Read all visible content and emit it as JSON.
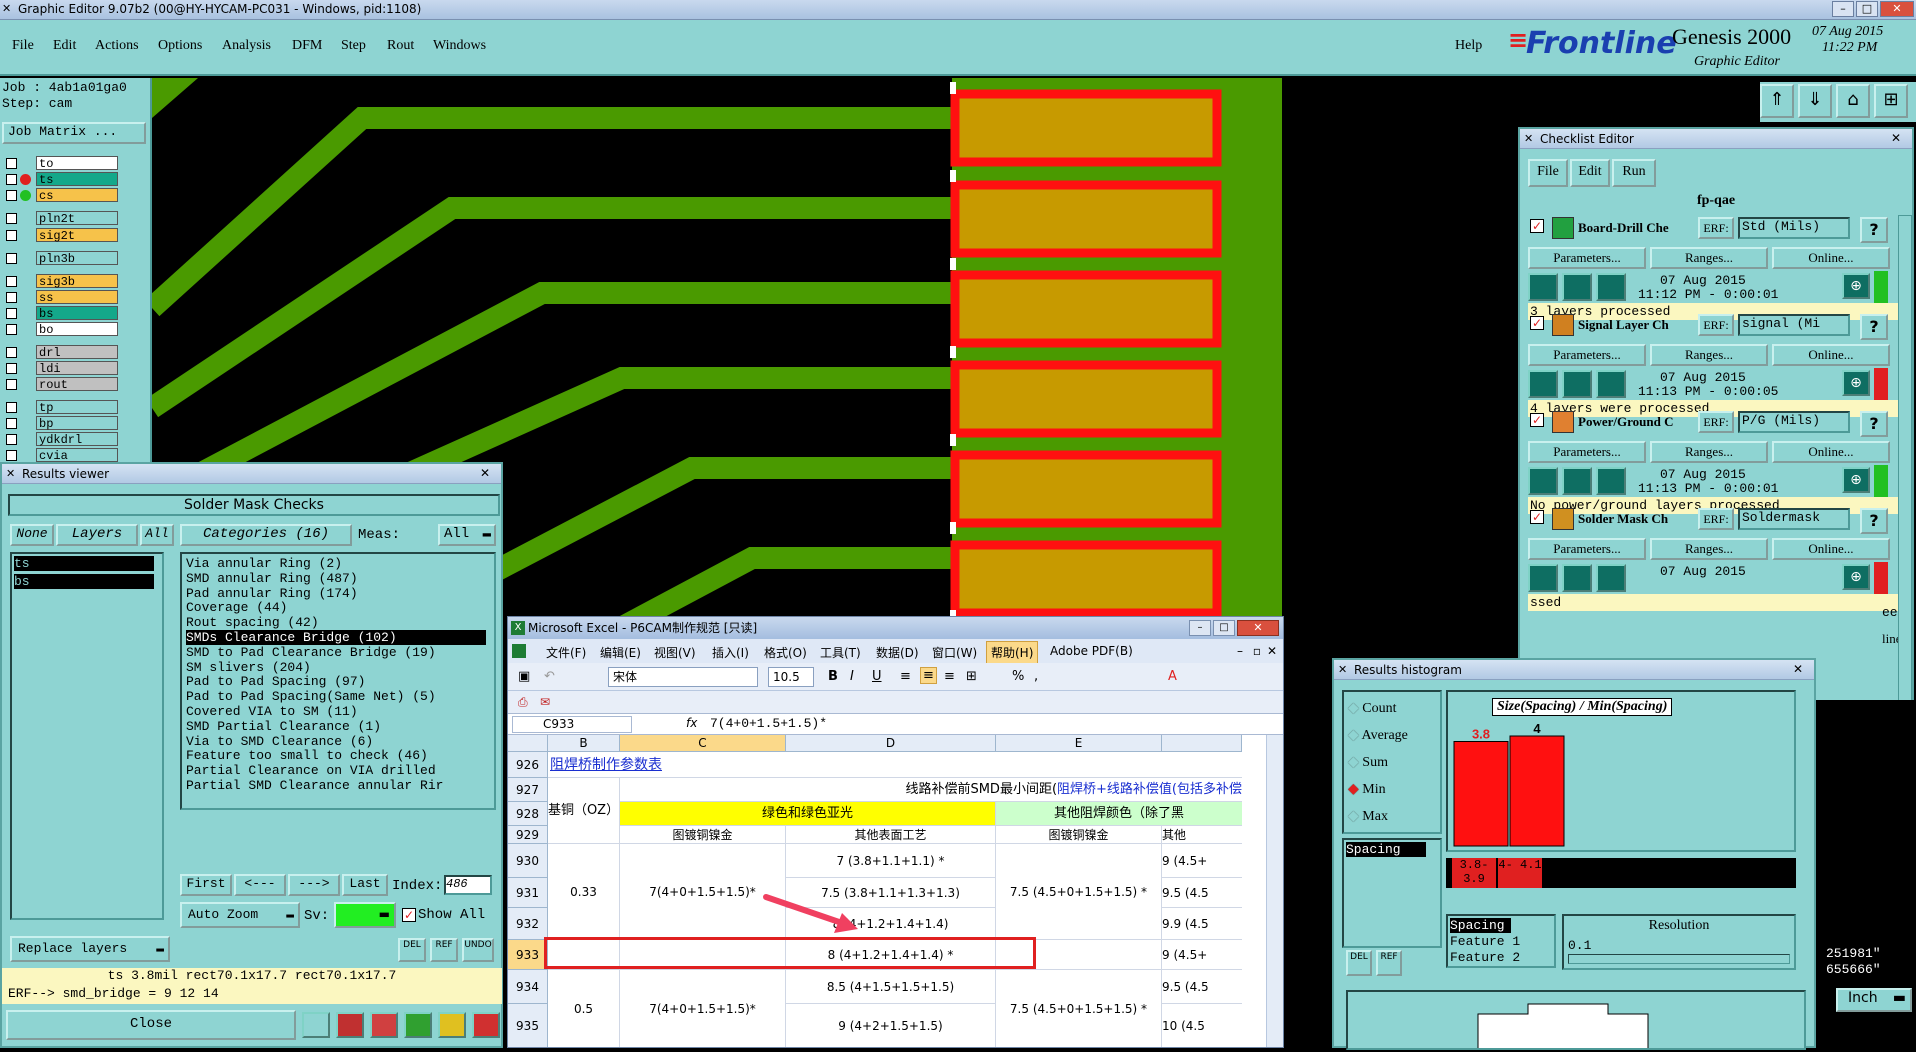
{
  "title_bar": {
    "text": "Graphic Editor 9.07b2 (00@HY-HYCAM-PC031 - Windows, pid:1108)"
  },
  "menu": {
    "items": [
      "File",
      "Edit",
      "Actions",
      "Options",
      "Analysis",
      "DFM",
      "Step",
      "Rout",
      "Windows"
    ],
    "help": "Help",
    "brand": "Frontline",
    "product": "Genesis 2000",
    "subtitle": "Graphic Editor",
    "date": "07 Aug 2015",
    "time": "11:22 PM"
  },
  "left_panel": {
    "job": "Job : 4ab1a01ga0",
    "step": "Step: cam",
    "job_matrix": "Job Matrix ...",
    "layers": [
      {
        "name": "to",
        "color": "#ffffff"
      },
      {
        "name": "ts",
        "color": "#14a88a"
      },
      {
        "name": "cs",
        "color": "#f6c24a"
      },
      {
        "name": "pln2t",
        "color": "#8ed4d2"
      },
      {
        "name": "sig2t",
        "color": "#f6c24a"
      },
      {
        "name": "pln3b",
        "color": "#8ed4d2"
      },
      {
        "name": "sig3b",
        "color": "#f6c24a"
      },
      {
        "name": "ss",
        "color": "#f6c24a"
      },
      {
        "name": "bs",
        "color": "#14a88a"
      },
      {
        "name": "bo",
        "color": "#ffffff"
      },
      {
        "name": "drl",
        "color": "#c0c0c0"
      },
      {
        "name": "ldi",
        "color": "#c0c0c0"
      },
      {
        "name": "rout",
        "color": "#c0c0c0"
      },
      {
        "name": "tp",
        "color": "#8ed4d2"
      },
      {
        "name": "bp",
        "color": "#8ed4d2"
      },
      {
        "name": "ydkdrl",
        "color": "#8ed4d2"
      },
      {
        "name": "cvia",
        "color": "#8ed4d2"
      }
    ]
  },
  "results_viewer": {
    "title": "Results viewer",
    "header": "Solder Mask Checks",
    "none_btn": "None",
    "layers_btn": "Layers",
    "all_btn": "All",
    "layers": [
      "ts",
      "bs"
    ],
    "categories_label": "Categories (16)",
    "meas_label": "Meas:",
    "meas_value": "All",
    "categories": [
      "Via annular Ring (2)",
      "SMD annular Ring (487)",
      "Pad annular Ring (174)",
      "Coverage (44)",
      "Rout spacing (42)",
      "SMDs Clearance Bridge (102)",
      "SMD to Pad Clearance Bridge (19)",
      "SM slivers (204)",
      "Pad to Pad Spacing (97)",
      "Pad to Pad Spacing(Same Net) (5)",
      "Covered VIA to SM (11)",
      "SMD Partial Clearance (1)",
      "Via to SMD Clearance (6)",
      "Feature too small to check (46)",
      "Partial Clearance on VIA drilled",
      "Partial SMD Clearance annular Rir"
    ],
    "selected_index": 5,
    "first": "First",
    "prev": "<---",
    "next": "--->",
    "last": "Last",
    "index_label": "Index:",
    "index_value": "486",
    "auto_zoom": "Auto Zoom",
    "sv_label": "Sv:",
    "show_all": "Show All",
    "replace_layers": "Replace layers",
    "del": "DEL",
    "ref": "REF",
    "undo": "UNDO",
    "status1": "ts 3.8mil  rect70.1x17.7  rect70.1x17.7",
    "status2": "ERF--> smd_bridge = 9 12 14",
    "close": "Close"
  },
  "excel": {
    "title": "Microsoft Excel - P6CAM制作规范 [只读]",
    "menu": [
      "文件(F)",
      "编辑(E)",
      "视图(V)",
      "插入(I)",
      "格式(O)",
      "工具(T)",
      "数据(D)",
      "窗口(W)",
      "帮助(H)",
      "Adobe PDF(B)"
    ],
    "font": "宋体",
    "size": "10.5",
    "cell_ref": "C933",
    "formula": "7(4+0+1.5+1.5)*",
    "columns": [
      "B",
      "C",
      "D",
      "E"
    ],
    "rows": [
      "926",
      "927",
      "928",
      "929",
      "930",
      "931",
      "932",
      "933",
      "934",
      "935"
    ],
    "r926": "阻焊桥制作参数表",
    "r927_a": "线路补偿前SMD最小间距(",
    "r927_b": "阻焊桥+线路补偿值(包括多补偿",
    "base_cu": "基铜（OZ）",
    "green": "绿色和绿色亚光",
    "other_color": "其他阻焊颜色（除了黑",
    "plating": "图镀铜镍金",
    "other_finish": "其他表面工艺",
    "plating2": "图镀铜镍金",
    "other_short": "其他",
    "v033": "0.33",
    "c930": "7(4+0+1.5+1.5)*",
    "d930": "7 (3.8+1.1+1.1) *",
    "d931": "7.5 (3.8+1.1+1.3+1.3)",
    "d932": "8 (4+1.2+1.4+1.4)",
    "d933": "8 (4+1.2+1.4+1.4) *",
    "e930": "7.5 (4.5+0+1.5+1.5) *",
    "f930": "9 (4.5+",
    "f931": "9.5 (4.5",
    "f932": "9.9 (4.5",
    "f933": "9 (4.5+",
    "v05": "0.5",
    "c934": "7(4+0+1.5+1.5)*",
    "d934": "8.5 (4+1.5+1.5+1.5)",
    "d935": "9 (4+2+1.5+1.5)",
    "e934": "7.5 (4.5+0+1.5+1.5) *",
    "f934": "9.5 (4.5",
    "f935": "10 (4.5"
  },
  "checklist": {
    "title": "Checklist Editor",
    "menu": [
      "File",
      "Edit",
      "Run"
    ],
    "name": "fp-qae",
    "erf": "ERF:",
    "params": "Parameters...",
    "ranges": "Ranges...",
    "online": "Online...",
    "items": [
      {
        "name": "Board-Drill Che",
        "erf": "Std (Mils)",
        "date": "07 Aug 2015",
        "time": "11:12 PM - 0:00:01",
        "msg": "3 layers processed",
        "status": "#22c022"
      },
      {
        "name": "Signal Layer Ch",
        "erf": "signal (Mi",
        "date": "07 Aug 2015",
        "time": "11:13 PM - 0:00:05",
        "msg": "4 layers were processed",
        "status": "#e02020"
      },
      {
        "name": "Power/Ground C",
        "erf": "P/G (Mils)",
        "date": "07 Aug 2015",
        "time": "11:13 PM - 0:00:01",
        "msg": "No power/ground layers processed",
        "status": "#22c022"
      },
      {
        "name": "Solder Mask Ch",
        "erf": "Soldermask",
        "date": "07 Aug 2015",
        "time": "",
        "msg": "ssed",
        "status": "#e02020"
      }
    ],
    "peek1": "een",
    "peek2": "line..."
  },
  "histogram": {
    "title": "Results histogram",
    "options": [
      "Count",
      "Average",
      "Sum",
      "Min",
      "Max"
    ],
    "selected": "Min",
    "list": [
      "Spacing"
    ],
    "chart_title": "Size(Spacing) / Min(Spacing)",
    "bars": [
      {
        "label": "3.8",
        "value": 3.8,
        "range": "3.8- 3.9"
      },
      {
        "label": "4",
        "value": 4.0,
        "range": "4- 4.1"
      }
    ],
    "features": [
      "Spacing",
      "Feature 1",
      "Feature 2"
    ],
    "resolution_label": "Resolution",
    "resolution_value": "0.1",
    "del": "DEL",
    "ref": "REF"
  },
  "right_edge": {
    "v1": "251981\"",
    "v2": "655666\"",
    "units": "Inch"
  }
}
